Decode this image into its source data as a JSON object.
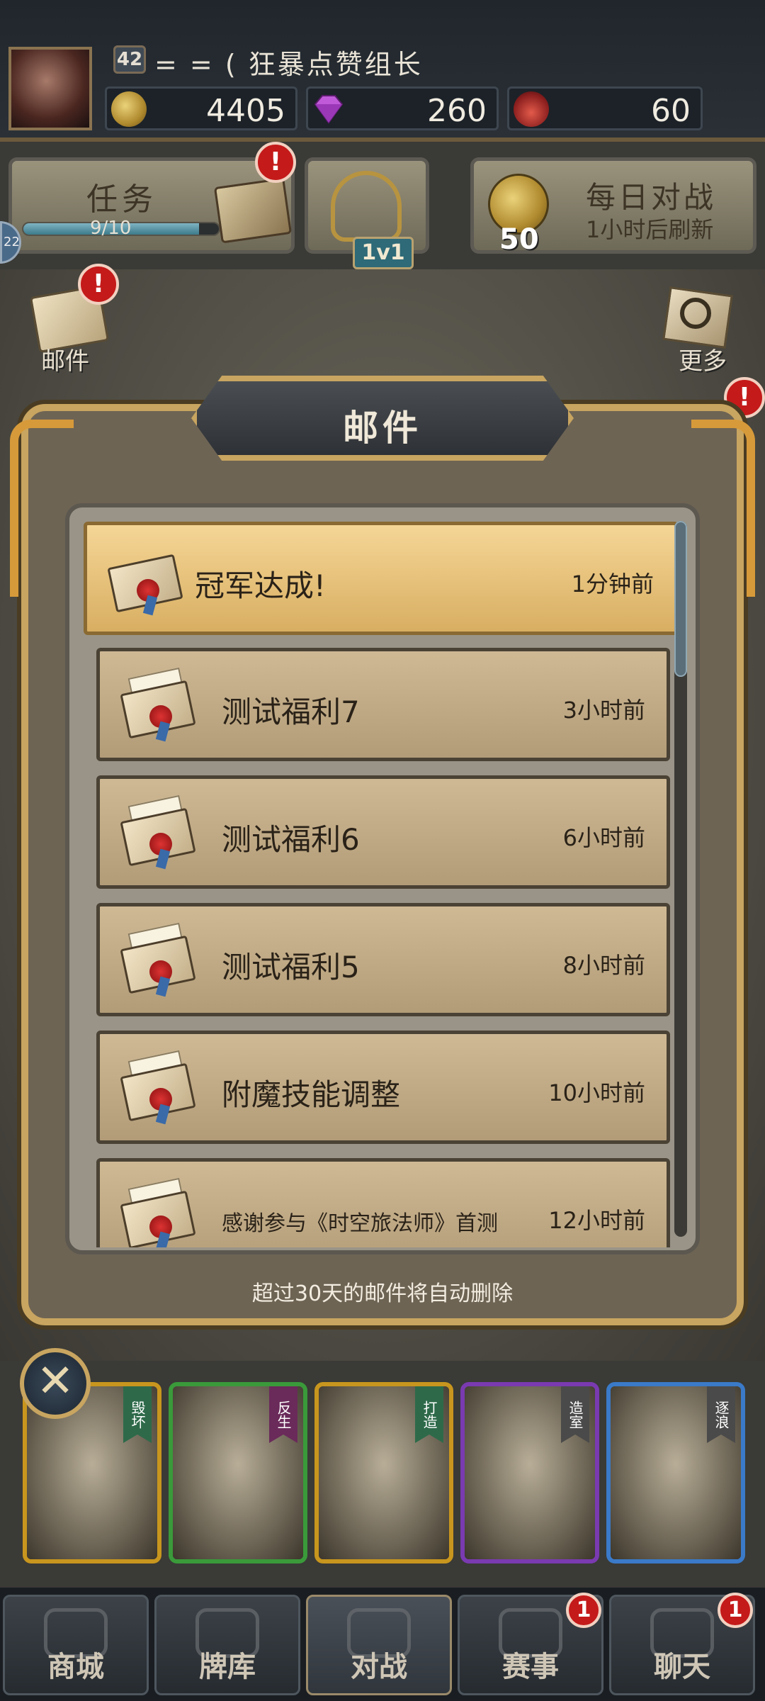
{
  "player": {
    "level": "42",
    "name": "= = ( 狂暴点赞组长"
  },
  "resources": {
    "gold": "4405",
    "gems": "260",
    "potions": "60"
  },
  "tasks": {
    "label": "任务",
    "progress_text": "9/10",
    "progress_fraction": 0.9,
    "badge": "!"
  },
  "pvp": {
    "label": "1v1"
  },
  "daily_battle": {
    "title": "每日对战",
    "subtitle": "1小时后刷新",
    "reward": "50"
  },
  "side": {
    "mail_label": "邮件",
    "more_label": "更多",
    "mail_badge": "!",
    "more_badge": "!",
    "left_edge": "22"
  },
  "mail_panel": {
    "title": "邮件",
    "footer": "超过30天的邮件将自动删除",
    "items": [
      {
        "title": "冠军达成!",
        "time": "1分钟前"
      },
      {
        "title": "测试福利7",
        "time": "3小时前"
      },
      {
        "title": "测试福利6",
        "time": "6小时前"
      },
      {
        "title": "测试福利5",
        "time": "8小时前"
      },
      {
        "title": "附魔技能调整",
        "time": "10小时前"
      },
      {
        "title": "感谢参与《时空旅法师》首测",
        "time": "12小时前"
      }
    ]
  },
  "cards": [
    {
      "tag": "毁坏",
      "border": "#c8961e",
      "tag_color": "#2e6a4a"
    },
    {
      "tag": "反生",
      "border": "#3a9a3a",
      "tag_color": "#6a2a5a"
    },
    {
      "tag": "打造",
      "border": "#c8961e",
      "tag_color": "#2e6a4a"
    },
    {
      "tag": "造室",
      "border": "#7a3ab0",
      "tag_color": "#4a4a4a"
    },
    {
      "tag": "逐浪",
      "border": "#3a7ac8",
      "tag_color": "#4a4a4a"
    }
  ],
  "close_icon": "close-x-icon",
  "nav": [
    {
      "label": "商城",
      "badge": ""
    },
    {
      "label": "牌库",
      "badge": ""
    },
    {
      "label": "对战",
      "badge": ""
    },
    {
      "label": "赛事",
      "badge": "1"
    },
    {
      "label": "聊天",
      "badge": "1"
    }
  ],
  "colors": {
    "accent_gold": "#c8a560",
    "badge_red": "#c41a1a",
    "active_mail": "#f5d696"
  }
}
